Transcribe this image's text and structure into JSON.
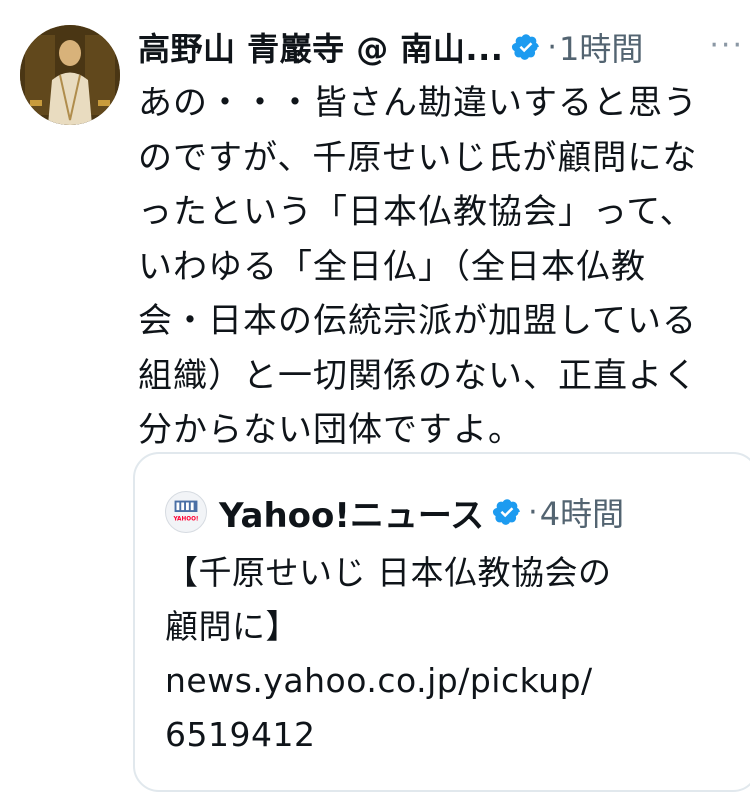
{
  "tweet": {
    "author_name": "高野山 青巖寺 @ 南山...",
    "verified_icon": "verified-badge-icon",
    "separator": "·",
    "time": "1時間",
    "more_icon": "···",
    "body_lines": [
      "あの・・・皆さん勘違いすると思う",
      "のですが、千原せいじ氏が顧問にな",
      "ったという「日本仏教協会」って、",
      "いわゆる「全日仏」（全日本仏教",
      "会・日本の伝統宗派が加盟している",
      "組織）と一切関係のない、正直よく",
      "分からない団体ですよ。"
    ]
  },
  "quote": {
    "logo_text": "YAHOO!",
    "author_name": "Yahoo!ニュース",
    "separator": "·",
    "time": "4時間",
    "text_lines": [
      "【千原せいじ 日本仏教協会の",
      "顧問に】",
      "news.yahoo.co.jp/pickup/",
      "6519412"
    ]
  },
  "colors": {
    "verified": "#1d9bf0",
    "secondary_text": "#536471",
    "border": "#e1e8ed"
  }
}
